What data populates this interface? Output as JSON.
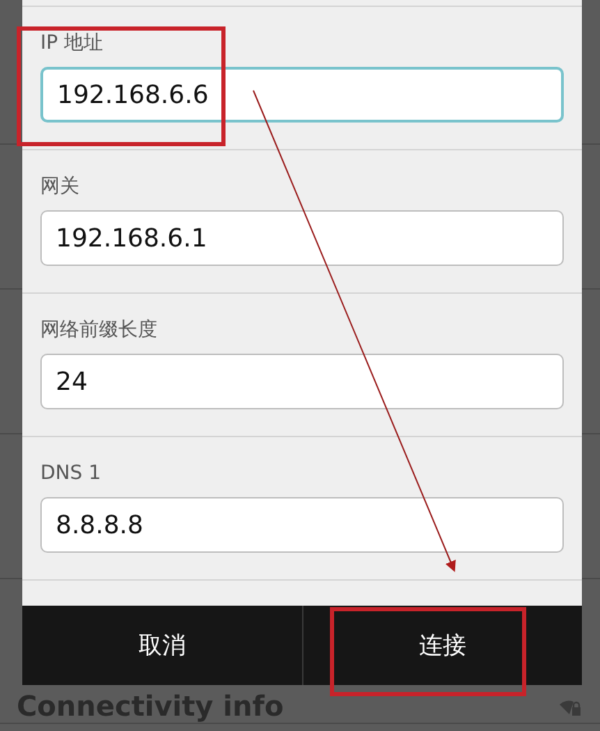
{
  "dialog": {
    "fields": [
      {
        "label": "IP 地址",
        "value": "192.168.6.6",
        "focused": true,
        "highlighted": true
      },
      {
        "label": "网关",
        "value": "192.168.6.1",
        "focused": false,
        "highlighted": false
      },
      {
        "label": "网络前缀长度",
        "value": "24",
        "focused": false,
        "highlighted": false
      },
      {
        "label": "DNS 1",
        "value": "8.8.8.8",
        "focused": false,
        "highlighted": false
      }
    ],
    "buttons": [
      {
        "label": "取消",
        "highlighted": false
      },
      {
        "label": "连接",
        "highlighted": true
      }
    ]
  },
  "background": {
    "footer_text": "Connectivity info"
  }
}
